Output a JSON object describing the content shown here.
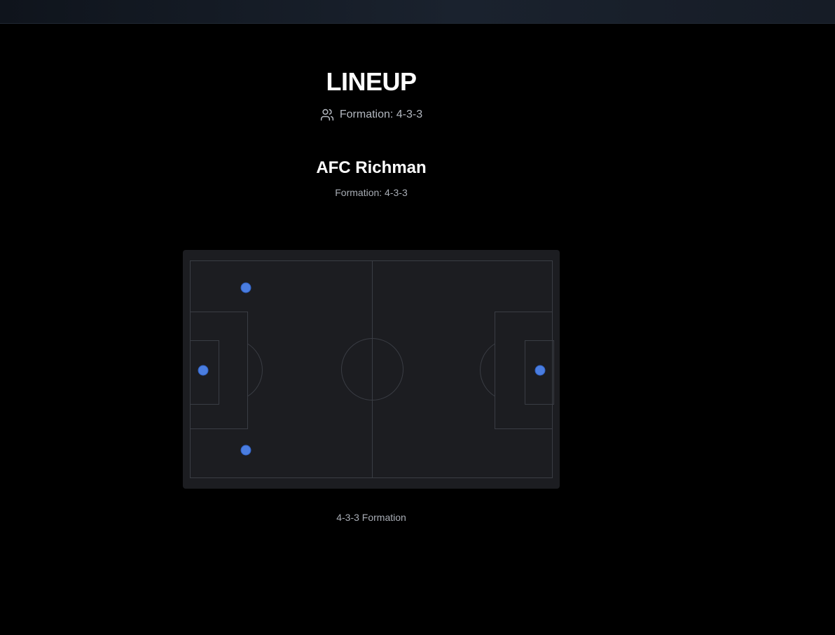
{
  "header": {
    "title": "LINEUP",
    "formation_label": "Formation: 4-3-3",
    "formation_icon": "users-icon"
  },
  "team": {
    "name": "AFC Richman",
    "formation_label": "Formation: 4-3-3"
  },
  "pitch": {
    "caption": "4-3-3 Formation",
    "player_color": "#4a7de0",
    "line_color": "#3a3d44",
    "surface_color": "#1c1d21"
  }
}
